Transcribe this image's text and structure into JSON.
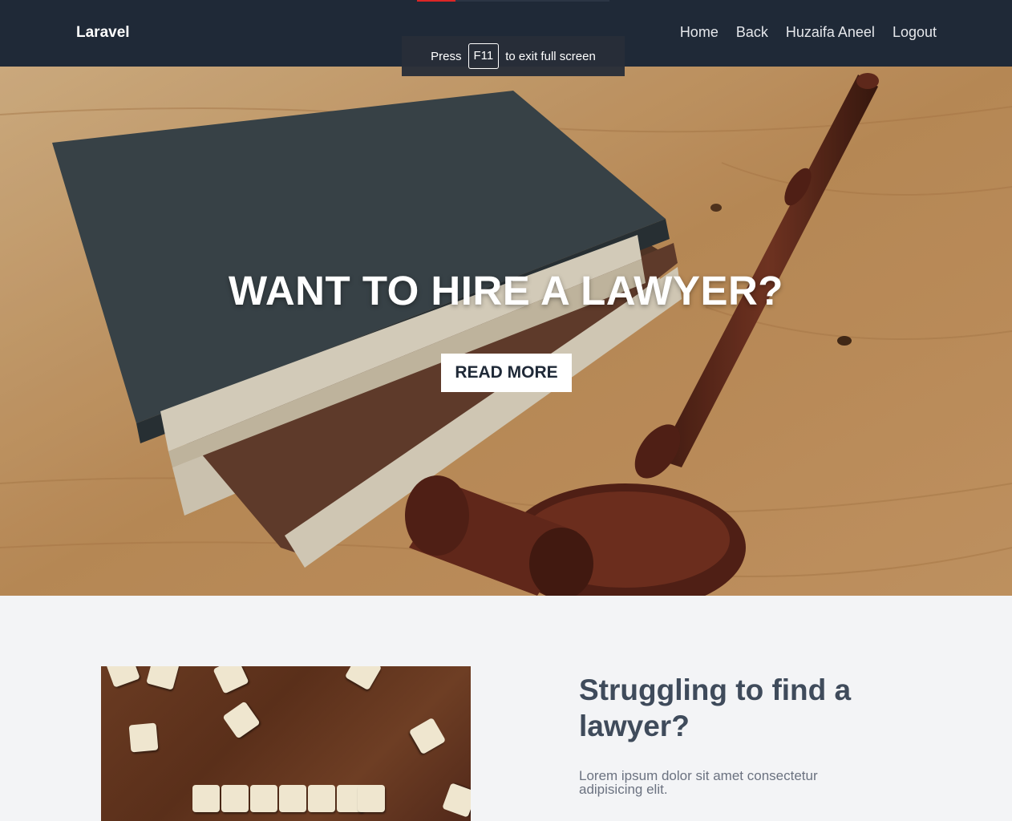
{
  "navbar": {
    "brand": "Laravel",
    "links": [
      "Home",
      "Back",
      "Huzaifa Aneel",
      "Logout"
    ]
  },
  "fullscreen_notice": {
    "prefix": "Press",
    "key": "F11",
    "suffix": "to exit full screen"
  },
  "hero": {
    "title": "WANT TO HIRE A LAWYER?",
    "button_label": "READ MORE"
  },
  "section": {
    "heading": "Struggling to find a lawyer?",
    "text": "Lorem ipsum dolor sit amet consectetur adipisicing elit."
  },
  "colors": {
    "navbar_bg": "#1f2937",
    "page_bg": "#f3f4f6",
    "heading": "#3f4b5b",
    "body_text": "#6b7280"
  }
}
